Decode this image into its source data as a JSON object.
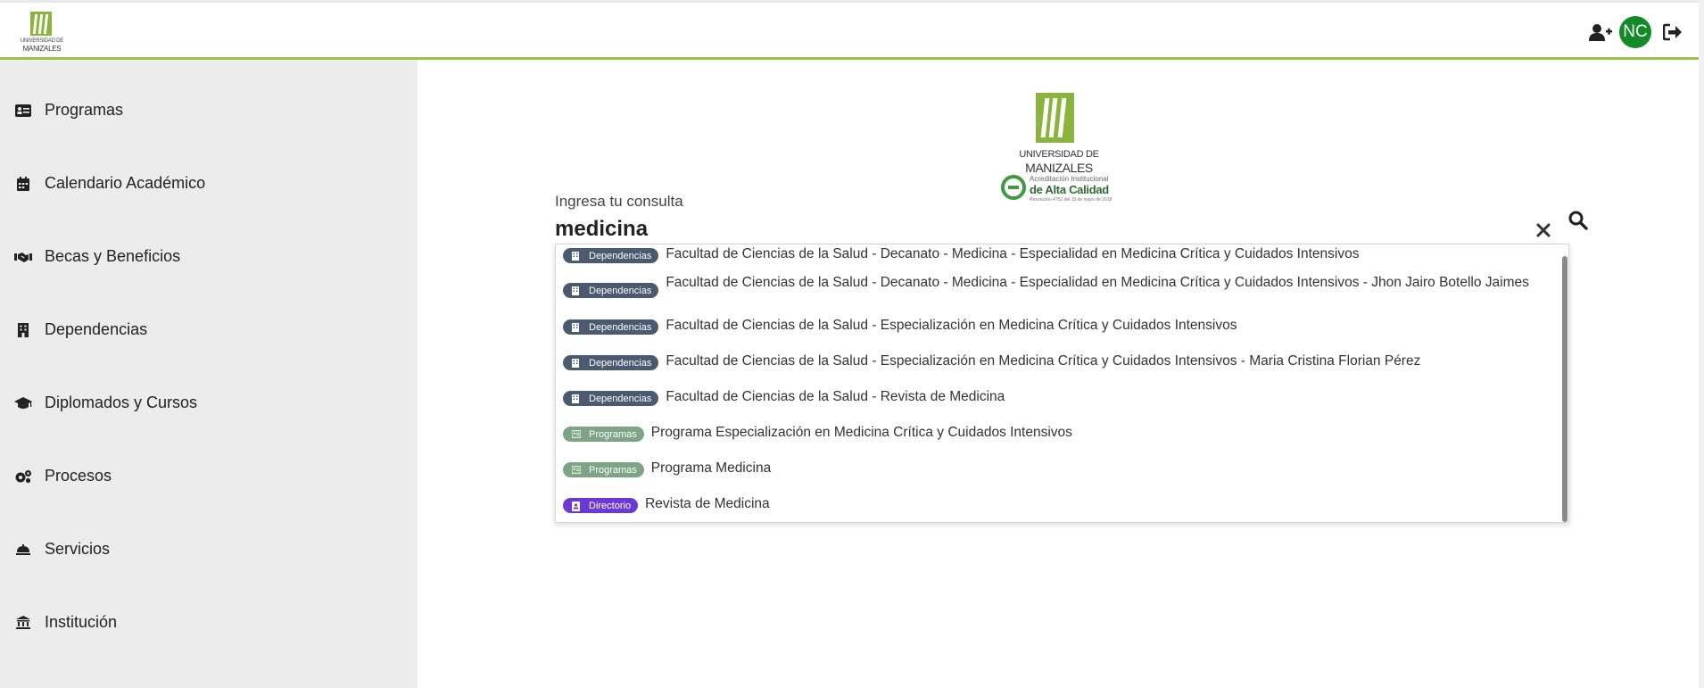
{
  "header": {
    "logo_line1": "UNIVERSIDAD DE",
    "logo_line2": "MANIZALES",
    "avatar_initials": "NC",
    "icons": [
      "add-user-icon",
      "logout-icon"
    ]
  },
  "sidebar": {
    "items": [
      {
        "label": "Programas",
        "icon": "id-card-icon"
      },
      {
        "label": "Calendario Académico",
        "icon": "calendar-icon"
      },
      {
        "label": "Becas y Beneficios",
        "icon": "handshake-icon"
      },
      {
        "label": "Dependencias",
        "icon": "building-icon"
      },
      {
        "label": "Diplomados y Cursos",
        "icon": "graduation-cap-icon"
      },
      {
        "label": "Procesos",
        "icon": "gears-icon"
      },
      {
        "label": "Servicios",
        "icon": "bell-service-icon"
      },
      {
        "label": "Institución",
        "icon": "institution-icon"
      }
    ]
  },
  "main_logo": {
    "line1": "UNIVERSIDAD DE",
    "line2": "MANIZALES",
    "accred_small": "Acreditación Institucional",
    "accred_big": "de Alta Calidad",
    "accred_tiny": "Resolución 4752 del 15 de mayo de 2018"
  },
  "search": {
    "label": "Ingresa tu consulta",
    "value": "medicina",
    "results": [
      {
        "badge": "Dependencias",
        "type": "dep",
        "text": "Facultad de Ciencias de la Salud - Decanato - Medicina - Especialidad en Medicina Crítica y Cuidados Intensivos"
      },
      {
        "badge": "Dependencias",
        "type": "dep",
        "text": "Facultad de Ciencias de la Salud - Decanato - Medicina - Especialidad en Medicina Crítica y Cuidados Intensivos - Jhon Jairo Botello Jaimes"
      },
      {
        "badge": "Dependencias",
        "type": "dep",
        "text": "Facultad de Ciencias de la Salud - Especialización en Medicina Crítica y Cuidados Intensivos"
      },
      {
        "badge": "Dependencias",
        "type": "dep",
        "text": "Facultad de Ciencias de la Salud - Especialización en Medicina Crítica y Cuidados Intensivos - Maria Cristina Florian Pérez"
      },
      {
        "badge": "Dependencias",
        "type": "dep",
        "text": "Facultad de Ciencias de la Salud - Revista de Medicina"
      },
      {
        "badge": "Programas",
        "type": "prog",
        "text": "Programa Especialización en Medicina Crítica y Cuidados Intensivos"
      },
      {
        "badge": "Programas",
        "type": "prog",
        "text": "Programa Medicina"
      },
      {
        "badge": "Directorio",
        "type": "dir",
        "text": "Revista de Medicina"
      }
    ]
  },
  "colors": {
    "header_accent": "#9cc146",
    "avatar": "#128a26",
    "badge_dependencias": "#4a5a70",
    "badge_programas": "#7da487",
    "badge_directorio": "#6d39d6",
    "sidebar_bg": "#ececec"
  }
}
